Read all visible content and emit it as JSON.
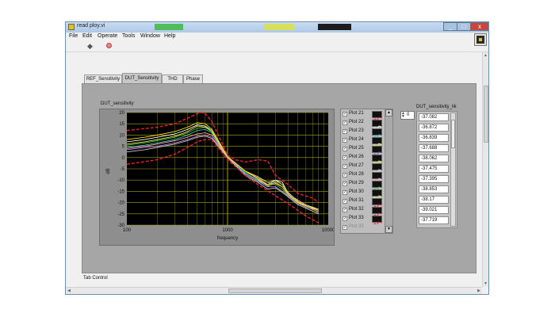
{
  "window": {
    "title": "read ploy.vi",
    "minimize": "_",
    "maximize": "□",
    "close": "x",
    "titlebar_strips": [
      "#4fbd5a",
      "#d7e05a",
      "#1c1c1c"
    ]
  },
  "menu": [
    "File",
    "Edit",
    "Operate",
    "Tools",
    "Window",
    "Help"
  ],
  "toolbar": {
    "run_icon": "run-arrow-icon",
    "stop_icon": "abort-icon"
  },
  "tabs": {
    "items": [
      {
        "label": "REF_Sensitivity"
      },
      {
        "label": "DUT_Sensitivity"
      },
      {
        "label": "THD"
      },
      {
        "label": "Phase"
      }
    ],
    "active": 1,
    "control_label": "Tab Control"
  },
  "graph": {
    "title": "DUT_sensitivity"
  },
  "chart_data": {
    "type": "line",
    "title": "DUT_sensitivity",
    "xlabel": "frequency",
    "ylabel": "dB",
    "xscale": "log",
    "xlim": [
      100,
      10000
    ],
    "ylim": [
      -30,
      20
    ],
    "x_ticks": [
      "100",
      "1000",
      "10000"
    ],
    "y_ticks": [
      "20",
      "15",
      "10",
      "5",
      "0",
      "-5",
      "-10",
      "-15",
      "-20",
      "-25",
      "-30"
    ],
    "grid": true,
    "background": "#000000",
    "limits": [
      {
        "name": "upper",
        "color": "#e8212a",
        "x": [
          100,
          200,
          300,
          400,
          500,
          550,
          600,
          700,
          900,
          1000,
          1200,
          1500,
          2000,
          2500,
          3000,
          4000,
          5000,
          7000,
          8000
        ],
        "y": [
          12,
          13.5,
          15,
          17.5,
          19.5,
          20,
          19.5,
          16,
          5.5,
          1,
          -1,
          -2,
          -1,
          -1.5,
          -8,
          -12,
          -16,
          -18,
          -20
        ]
      },
      {
        "name": "lower",
        "color": "#e8212a",
        "x": [
          100,
          200,
          300,
          400,
          500,
          600,
          700,
          1000,
          1200,
          1500,
          2000,
          3000,
          4000,
          5000,
          6000,
          8000
        ],
        "y": [
          -3,
          -1,
          1.5,
          4.5,
          7,
          8,
          8,
          -1,
          -4,
          -8,
          -12,
          -17,
          -20.5,
          -23.5,
          -26,
          -29
        ]
      }
    ],
    "x": [
      100,
      150,
      200,
      300,
      400,
      500,
      600,
      700,
      1000,
      1500,
      2000,
      2500,
      3000,
      3500,
      4000,
      5000,
      6000,
      8000
    ],
    "series": [
      {
        "color": "#ffffff",
        "values": [
          7,
          8,
          9,
          10.5,
          12.5,
          14.5,
          14,
          12,
          0,
          -7,
          -10,
          -12,
          -10,
          -11,
          -16,
          -19,
          -21,
          -23
        ]
      },
      {
        "color": "#3fbf3f",
        "values": [
          5.5,
          6.5,
          7.5,
          9,
          11,
          13,
          13.5,
          12,
          0,
          -6.5,
          -9,
          -11,
          -12,
          -14,
          -17,
          -20,
          -22,
          -24
        ]
      },
      {
        "color": "#3fbfbf",
        "values": [
          4.5,
          5.5,
          6.5,
          8,
          10,
          12,
          12.5,
          11,
          0,
          -7,
          -10,
          -13,
          -10.5,
          -12,
          -16,
          -20,
          -21,
          -23.5
        ]
      },
      {
        "color": "#e8e04a",
        "values": [
          6,
          7,
          8,
          9.5,
          11.5,
          14,
          13.5,
          11.5,
          0,
          -6,
          -8.5,
          -11,
          -10,
          -12,
          -15.5,
          -19.5,
          -21.5,
          -23
        ]
      },
      {
        "color": "#b080e0",
        "values": [
          3.5,
          4.5,
          5,
          6.5,
          8,
          9.5,
          10,
          9,
          0,
          -7.5,
          -10.5,
          -13,
          -13,
          -15,
          -17,
          -20.5,
          -22,
          -24
        ]
      },
      {
        "color": "#f5a0a0",
        "values": [
          4,
          5,
          6,
          7.5,
          9,
          10.5,
          11,
          10,
          0,
          -6,
          -9,
          -12,
          -11,
          -13,
          -16,
          -19,
          -21,
          -24.5
        ]
      },
      {
        "color": "#c8c8c8",
        "values": [
          2.5,
          3.5,
          4.5,
          6,
          7.5,
          9,
          9.5,
          8.5,
          0,
          -8,
          -11,
          -14,
          -13.5,
          -15.5,
          -17.5,
          -21,
          -22.5,
          -25
        ]
      },
      {
        "color": "#ffe600",
        "values": [
          8,
          9,
          10,
          11.5,
          13.5,
          15.5,
          15,
          12.5,
          0.5,
          -6,
          -9.5,
          -12.5,
          -11.5,
          -13,
          -16.5,
          -20,
          -21.5,
          -23.5
        ]
      }
    ]
  },
  "legend": {
    "items": [
      {
        "label": "Plot 21",
        "checked": "✓",
        "color": "#e8212a",
        "enabled": true
      },
      {
        "label": "Plot 22",
        "checked": "✓",
        "color": "#e8e8e8",
        "enabled": true
      },
      {
        "label": "Plot 23",
        "checked": "✓",
        "color": "#3fbfbf",
        "enabled": true
      },
      {
        "label": "Plot 24",
        "checked": "✓",
        "color": "#e8e04a",
        "enabled": true
      },
      {
        "label": "Plot 25",
        "checked": "✓",
        "color": "#8060c0",
        "enabled": true
      },
      {
        "label": "Plot 26",
        "checked": "✓",
        "color": "#e8e04a",
        "enabled": true
      },
      {
        "label": "Plot 27",
        "checked": "✓",
        "color": "#cfcfcf",
        "enabled": true
      },
      {
        "label": "Plot 28",
        "checked": "✓",
        "color": "#f5a0a0",
        "enabled": true
      },
      {
        "label": "Plot 29",
        "checked": "✓",
        "color": "#3fbf3f",
        "enabled": true
      },
      {
        "label": "Plot 30",
        "checked": "✓",
        "color": "#e8e04a",
        "enabled": true
      },
      {
        "label": "Plot 31",
        "checked": "✓",
        "color": "#e8212a",
        "enabled": true
      },
      {
        "label": "Plot 32",
        "checked": "✓",
        "color": "#e8212a",
        "enabled": true
      },
      {
        "label": "Plot 33",
        "checked": "✓",
        "color": "#e8212a",
        "enabled": true
      },
      {
        "label": "Plot 33",
        "checked": "✓",
        "color": "#bdbdbd",
        "enabled": false
      }
    ]
  },
  "array": {
    "label": "DUT_sensitivity_lik",
    "index": "0",
    "values": [
      "-37.082",
      "-36.872",
      "-36.839",
      "-37.688",
      "-38.062",
      "-37.475",
      "-37.395",
      "-38.853",
      "-38.17",
      "-39.021",
      "-37.719"
    ]
  }
}
